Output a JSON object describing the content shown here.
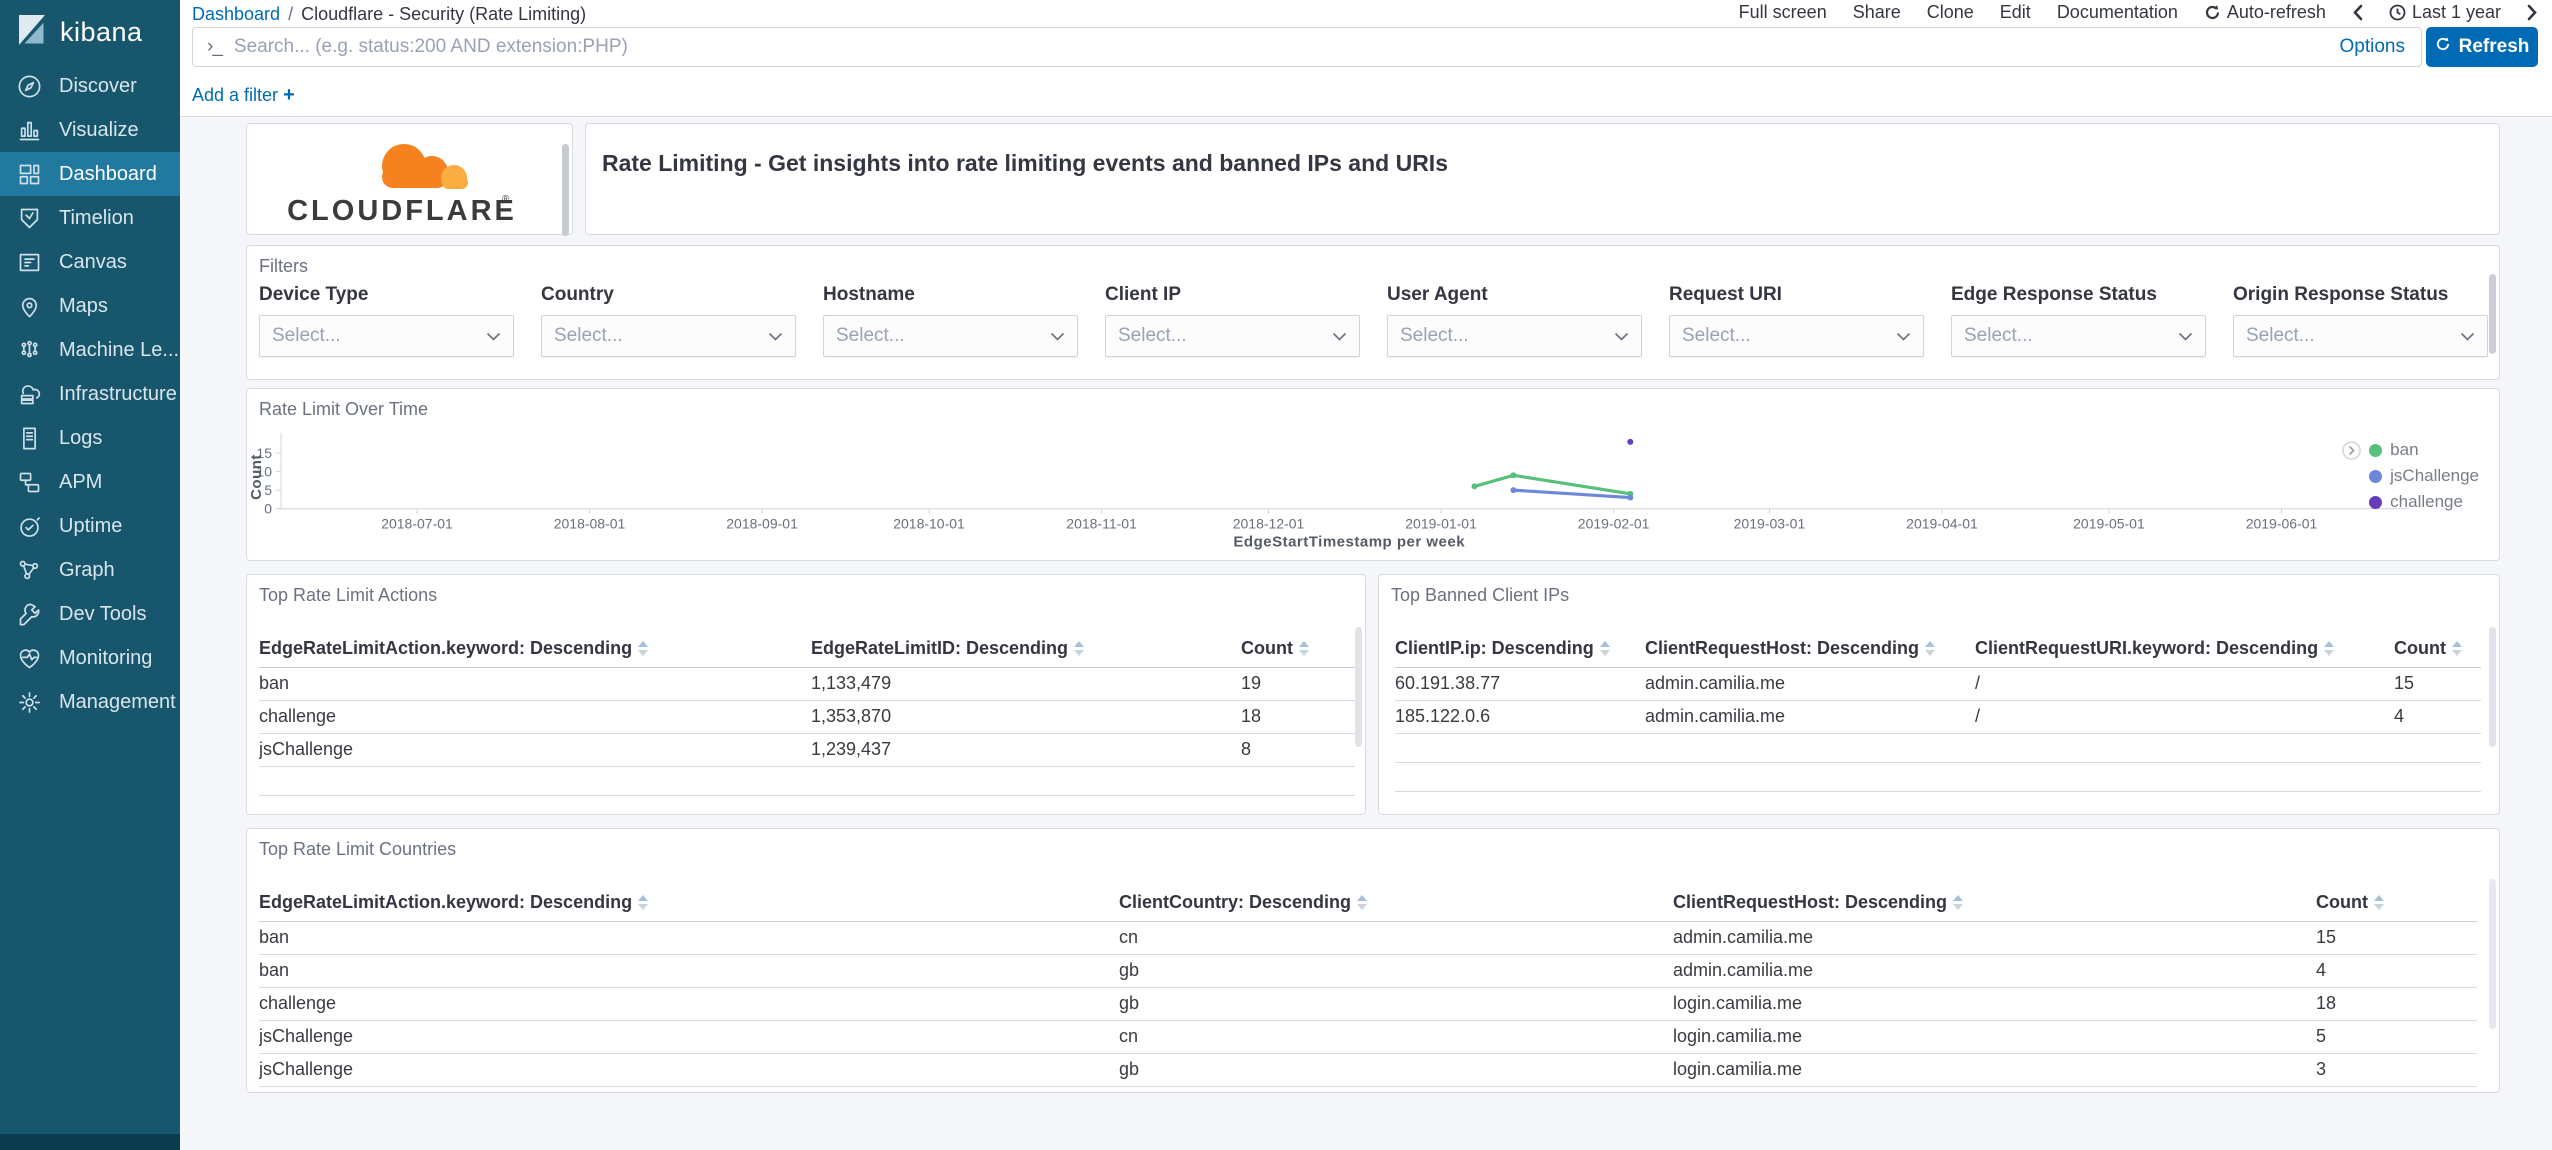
{
  "sidebar": {
    "product": "kibana",
    "items": [
      {
        "label": "Discover",
        "active": false
      },
      {
        "label": "Visualize",
        "active": false
      },
      {
        "label": "Dashboard",
        "active": true
      },
      {
        "label": "Timelion",
        "active": false
      },
      {
        "label": "Canvas",
        "active": false
      },
      {
        "label": "Maps",
        "active": false
      },
      {
        "label": "Machine Le...",
        "active": false
      },
      {
        "label": "Infrastructure",
        "active": false
      },
      {
        "label": "Logs",
        "active": false
      },
      {
        "label": "APM",
        "active": false
      },
      {
        "label": "Uptime",
        "active": false
      },
      {
        "label": "Graph",
        "active": false
      },
      {
        "label": "Dev Tools",
        "active": false
      },
      {
        "label": "Monitoring",
        "active": false
      },
      {
        "label": "Management",
        "active": false
      }
    ]
  },
  "topbar": {
    "breadcrumb": {
      "link": "Dashboard",
      "separator": "/",
      "current": "Cloudflare - Security (Rate Limiting)"
    },
    "menu": [
      {
        "label": "Full screen"
      },
      {
        "label": "Share"
      },
      {
        "label": "Clone"
      },
      {
        "label": "Edit"
      },
      {
        "label": "Documentation"
      },
      {
        "label": "Auto-refresh"
      }
    ],
    "time": {
      "prev": "‹",
      "range": "Last 1 year",
      "next": "›"
    }
  },
  "query_bar": {
    "prompt": "›_",
    "placeholder": "Search... (e.g. status:200 AND extension:PHP)",
    "options": "Options",
    "refresh": "Refresh"
  },
  "filter_bar": {
    "add_filter": "Add a filter",
    "plus": "+"
  },
  "panels": {
    "cloudflare": {
      "wordmark": "CLOUDFLARE",
      "registered": "®"
    },
    "description": {
      "text": "Rate Limiting - Get insights into rate limiting events and banned IPs and URIs"
    },
    "filters": {
      "title": "Filters",
      "select_placeholder": "Select...",
      "fields": [
        {
          "label": "Device Type"
        },
        {
          "label": "Country"
        },
        {
          "label": "Hostname"
        },
        {
          "label": "Client IP"
        },
        {
          "label": "User Agent"
        },
        {
          "label": "Request URI"
        },
        {
          "label": "Edge Response Status"
        },
        {
          "label": "Origin Response Status"
        }
      ]
    },
    "rate_limit_over_time": {
      "title": "Rate Limit Over Time"
    },
    "top_actions": {
      "title": "Top Rate Limit Actions",
      "columns": [
        "EdgeRateLimitAction.keyword: Descending",
        "EdgeRateLimitID: Descending",
        "Count"
      ],
      "rows": [
        [
          "ban",
          "1,133,479",
          "19"
        ],
        [
          "challenge",
          "1,353,870",
          "18"
        ],
        [
          "jsChallenge",
          "1,239,437",
          "8"
        ]
      ]
    },
    "top_banned_ips": {
      "title": "Top Banned Client IPs",
      "columns": [
        "ClientIP.ip: Descending",
        "ClientRequestHost: Descending",
        "ClientRequestURI.keyword: Descending",
        "Count"
      ],
      "rows": [
        [
          "60.191.38.77",
          "admin.camilia.me",
          "/",
          "15"
        ],
        [
          "185.122.0.6",
          "admin.camilia.me",
          "/",
          "4"
        ]
      ]
    },
    "top_countries": {
      "title": "Top Rate Limit Countries",
      "columns": [
        "EdgeRateLimitAction.keyword: Descending",
        "ClientCountry: Descending",
        "ClientRequestHost: Descending",
        "Count"
      ],
      "rows": [
        [
          "ban",
          "cn",
          "admin.camilia.me",
          "15"
        ],
        [
          "ban",
          "gb",
          "admin.camilia.me",
          "4"
        ],
        [
          "challenge",
          "gb",
          "login.camilia.me",
          "18"
        ],
        [
          "jsChallenge",
          "cn",
          "login.camilia.me",
          "5"
        ],
        [
          "jsChallenge",
          "gb",
          "login.camilia.me",
          "3"
        ]
      ]
    }
  },
  "chart_data": {
    "type": "line",
    "title": "Rate Limit Over Time",
    "xlabel": "EdgeStartTimestamp per week",
    "ylabel": "Count",
    "x_domain": [
      "2018-07-01",
      "2019-06-01"
    ],
    "x_ticks": [
      "2018-07-01",
      "2018-08-01",
      "2018-09-01",
      "2018-10-01",
      "2018-11-01",
      "2018-12-01",
      "2019-01-01",
      "2019-02-01",
      "2019-03-01",
      "2019-04-01",
      "2019-05-01",
      "2019-06-01"
    ],
    "y_ticks": [
      0,
      5,
      10,
      15
    ],
    "y_max": 18,
    "grid": false,
    "legend_position": "right",
    "series": [
      {
        "name": "ban",
        "color": "#57c17b",
        "points": [
          [
            "2019-01-07",
            6
          ],
          [
            "2019-01-14",
            9
          ],
          [
            "2019-02-04",
            4
          ]
        ]
      },
      {
        "name": "jsChallenge",
        "color": "#6f87d8",
        "points": [
          [
            "2019-01-14",
            5
          ],
          [
            "2019-02-04",
            3
          ]
        ]
      },
      {
        "name": "challenge",
        "color": "#663db8",
        "points": [
          [
            "2019-02-04",
            18
          ]
        ]
      }
    ]
  }
}
